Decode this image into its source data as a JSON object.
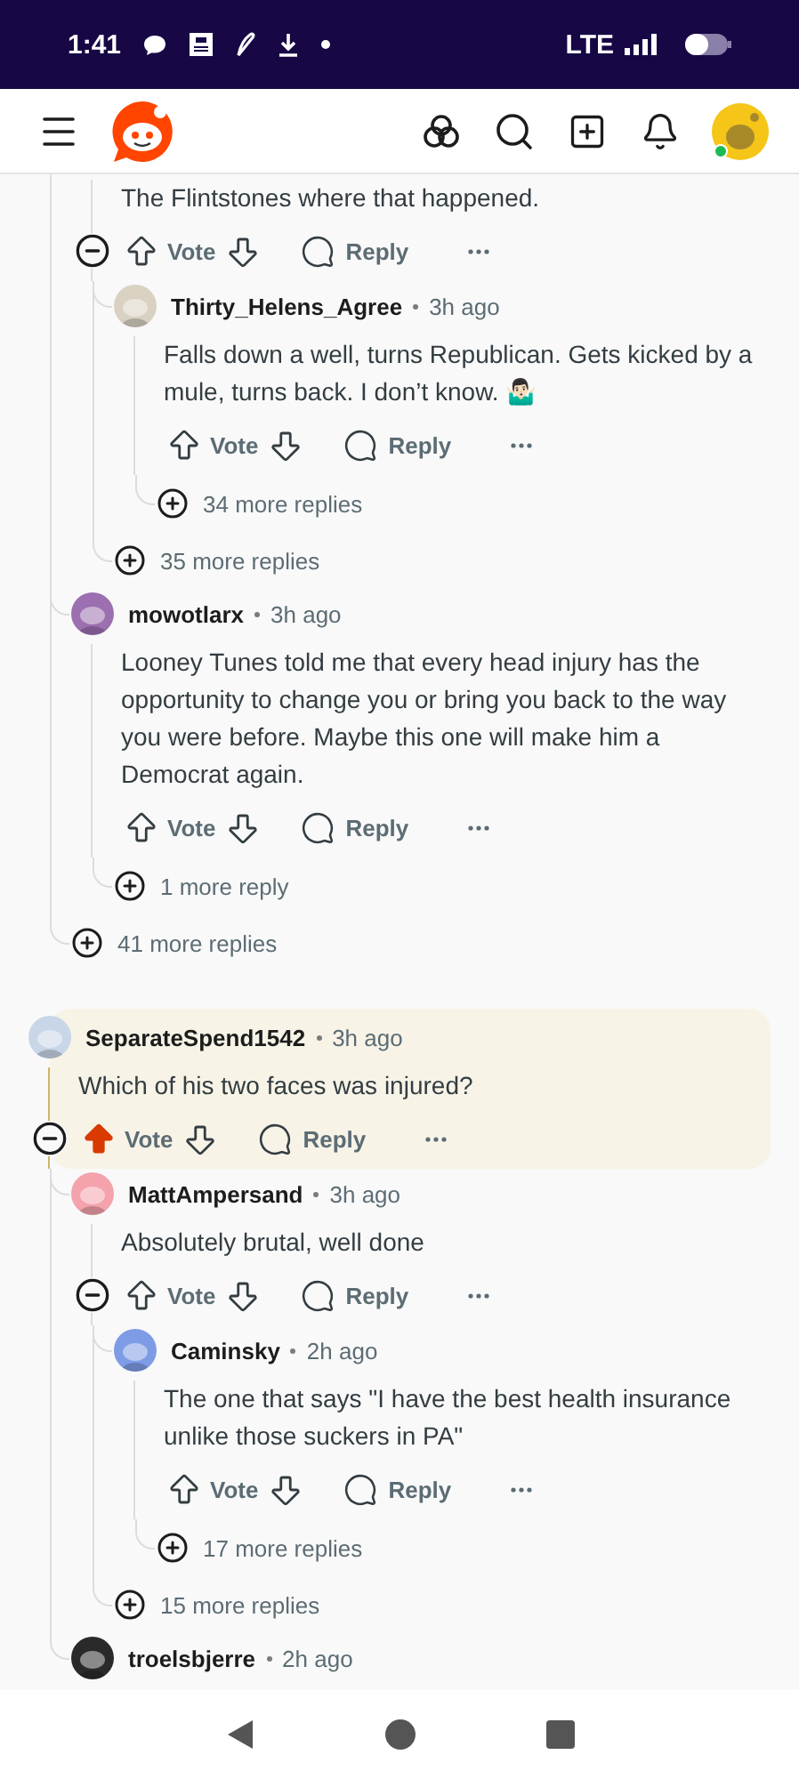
{
  "status_bar": {
    "time": "1:41",
    "network": "LTE"
  },
  "thread": [
    {
      "kind": "continued",
      "children": [
        {
          "kind": "comment",
          "body": "The Flintstones where that happened.",
          "collapsible": true,
          "upvoted": false,
          "vote": "Vote",
          "reply": "Reply",
          "children": [
            {
              "kind": "comment",
              "author": "Thirty_Helens_Agree",
              "time": "3h ago",
              "color": "#d9d2c3",
              "body": "Falls down a well, turns Republican. Gets kicked by a mule, turns back. I don’t know. 🤷🏻‍♂️",
              "collapsible": false,
              "upvoted": false,
              "vote": "Vote",
              "reply": "Reply",
              "children": [
                {
                  "kind": "more",
                  "label": "34 more replies"
                }
              ]
            },
            {
              "kind": "more",
              "label": "35 more replies"
            }
          ]
        },
        {
          "kind": "comment",
          "author": "mowotlarx",
          "time": "3h ago",
          "color": "#9b6fb0",
          "body": "Looney Tunes told me that every head injury has the opportunity to change you or bring you back to the way you were before. Maybe this one will make him a Democrat again.",
          "collapsible": false,
          "upvoted": false,
          "vote": "Vote",
          "reply": "Reply",
          "children": [
            {
              "kind": "more",
              "label": "1 more reply"
            }
          ]
        },
        {
          "kind": "more",
          "label": "41 more replies"
        }
      ]
    },
    {
      "kind": "comment",
      "author": "SeparateSpend1542",
      "time": "3h ago",
      "color": "#c8d6e8",
      "highlighted": true,
      "body": "Which of his two faces was injured?",
      "collapsible": true,
      "upvoted": true,
      "vote": "Vote",
      "reply": "Reply",
      "children": [
        {
          "kind": "comment",
          "author": "MattAmpersand",
          "time": "3h ago",
          "color": "#f4a3ad",
          "body": "Absolutely brutal, well done",
          "collapsible": true,
          "upvoted": false,
          "vote": "Vote",
          "reply": "Reply",
          "children": [
            {
              "kind": "comment",
              "author": "Caminsky",
              "time": "2h ago",
              "color": "#7e9be6",
              "body": "The one that says \"I have the best health insurance unlike those suckers in PA\"",
              "collapsible": false,
              "upvoted": false,
              "vote": "Vote",
              "reply": "Reply",
              "children": [
                {
                  "kind": "more",
                  "label": "17 more replies"
                }
              ]
            },
            {
              "kind": "more",
              "label": "15 more replies"
            }
          ]
        },
        {
          "kind": "comment",
          "author": "troelsbjerre",
          "time": "2h ago",
          "color": "#2a2a2a"
        }
      ]
    }
  ]
}
